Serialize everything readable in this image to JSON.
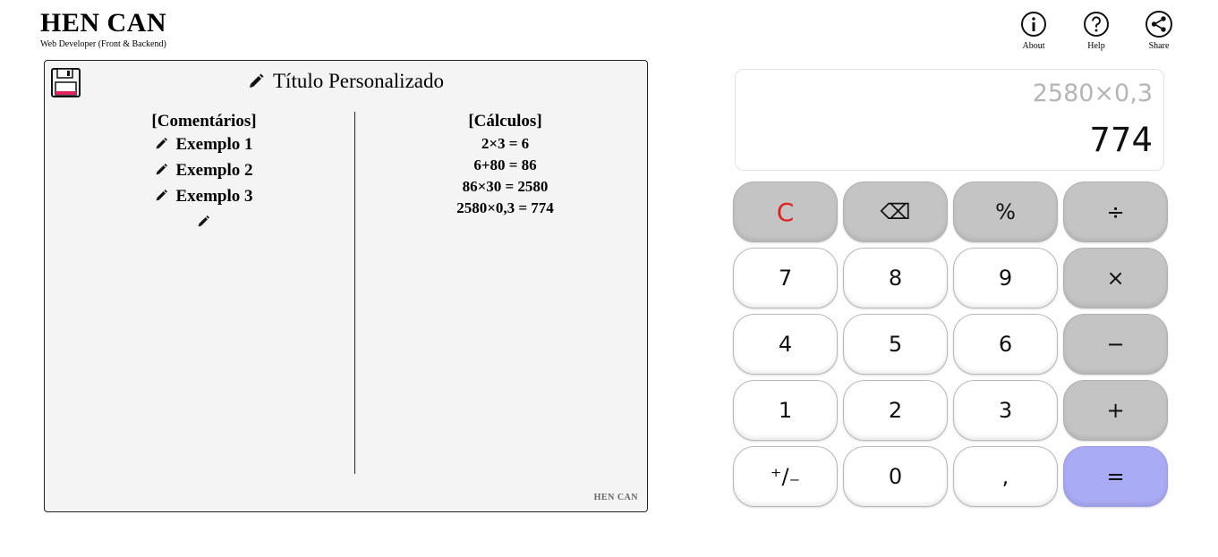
{
  "brand": {
    "title": "HEN CAN",
    "subtitle": "Web Developer (Front & Backend)"
  },
  "topnav": [
    {
      "icon": "info-icon",
      "label": "About"
    },
    {
      "icon": "help-icon",
      "label": "Help"
    },
    {
      "icon": "share-icon",
      "label": "Share"
    }
  ],
  "notepad": {
    "save_icon": "floppy-disk-icon",
    "title": "Título Personalizado",
    "comments_heading": "[Comentários]",
    "comments": [
      "Exemplo 1",
      "Exemplo 2",
      "Exemplo 3",
      ""
    ],
    "calculations_heading": "[Cálculos]",
    "calculations": [
      "2×3 = 6",
      "6+80 = 86",
      "86×30 = 2580",
      "2580×0,3 = 774"
    ],
    "watermark": "HEN CAN"
  },
  "calculator": {
    "expression": "2580×0,3",
    "result": "774",
    "keys": [
      {
        "label": "C",
        "name": "clear-button",
        "style": "clear"
      },
      {
        "label": "⌫",
        "name": "backspace-button",
        "style": "op"
      },
      {
        "label": "%",
        "name": "percent-button",
        "style": "op"
      },
      {
        "label": "÷",
        "name": "divide-button",
        "style": "op"
      },
      {
        "label": "7",
        "name": "digit-7-button",
        "style": "num"
      },
      {
        "label": "8",
        "name": "digit-8-button",
        "style": "num"
      },
      {
        "label": "9",
        "name": "digit-9-button",
        "style": "num"
      },
      {
        "label": "×",
        "name": "multiply-button",
        "style": "op"
      },
      {
        "label": "4",
        "name": "digit-4-button",
        "style": "num"
      },
      {
        "label": "5",
        "name": "digit-5-button",
        "style": "num"
      },
      {
        "label": "6",
        "name": "digit-6-button",
        "style": "num"
      },
      {
        "label": "−",
        "name": "subtract-button",
        "style": "op"
      },
      {
        "label": "1",
        "name": "digit-1-button",
        "style": "num"
      },
      {
        "label": "2",
        "name": "digit-2-button",
        "style": "num"
      },
      {
        "label": "3",
        "name": "digit-3-button",
        "style": "num"
      },
      {
        "label": "+",
        "name": "add-button",
        "style": "op"
      },
      {
        "label": "⁺/₋",
        "name": "toggle-sign-button",
        "style": "num"
      },
      {
        "label": "0",
        "name": "digit-0-button",
        "style": "num"
      },
      {
        "label": ",",
        "name": "decimal-comma-button",
        "style": "num"
      },
      {
        "label": "=",
        "name": "equals-button",
        "style": "eq"
      }
    ]
  }
}
